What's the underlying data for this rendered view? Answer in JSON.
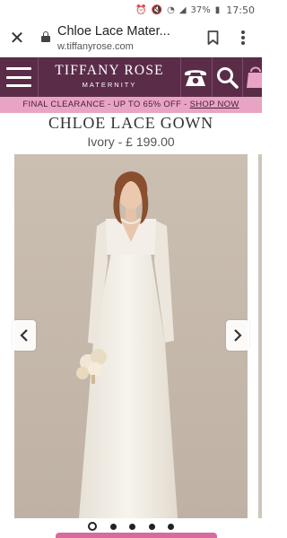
{
  "status_bar": {
    "battery": "37%",
    "time": "17:50"
  },
  "browser": {
    "page_title": "Chloe Lace Mater...",
    "url": "w.tiffanyrose.com"
  },
  "site_header": {
    "brand_name": "TIFFANY ROSE",
    "brand_sub": "MATERNITY"
  },
  "promo": {
    "text": "FINAL CLEARANCE - UP TO 65% OFF - ",
    "link": "SHOP NOW"
  },
  "product": {
    "name": "CHLOE LACE GOWN",
    "variant": "Ivory -   £ 199.00"
  },
  "carousel": {
    "slide_count": 5,
    "active_index": 0
  },
  "icons": [
    "close-icon",
    "lock-icon",
    "bookmark-icon",
    "overflow-menu-icon",
    "menu-icon",
    "phone-icon",
    "search-icon",
    "bag-icon",
    "chevron-left-icon",
    "chevron-right-icon"
  ],
  "colors": {
    "header": "#5a2c47",
    "promo": "#e8a4c2",
    "cta": "#d96a9e"
  }
}
